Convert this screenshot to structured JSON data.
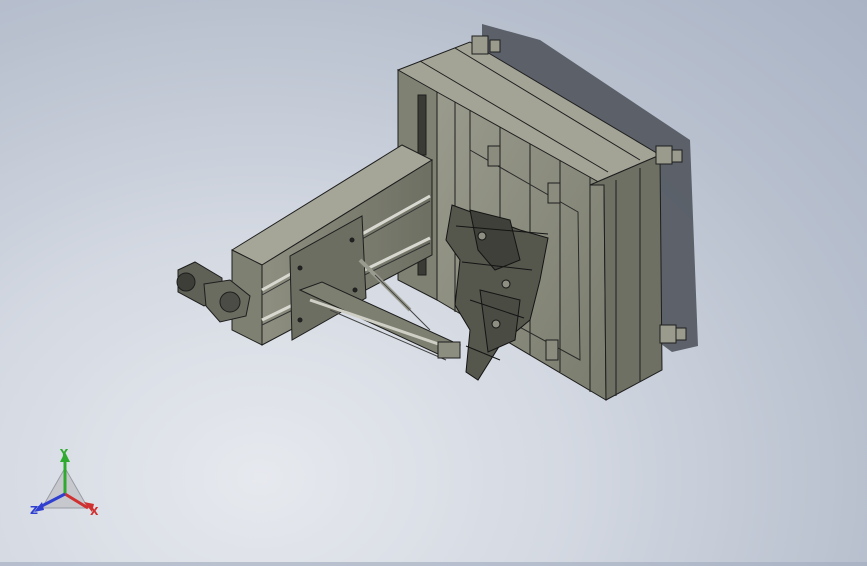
{
  "viewport": {
    "background_top": "#a9b3c4",
    "background_bottom": "#e6e9ee",
    "model_color": "#86887a",
    "edge_color": "#1e1e1e"
  },
  "triad": {
    "x_label": "X",
    "y_label": "Y",
    "z_label": "Z",
    "x_color": "#d03030",
    "y_color": "#2faa2f",
    "z_color": "#2f3fd0"
  }
}
